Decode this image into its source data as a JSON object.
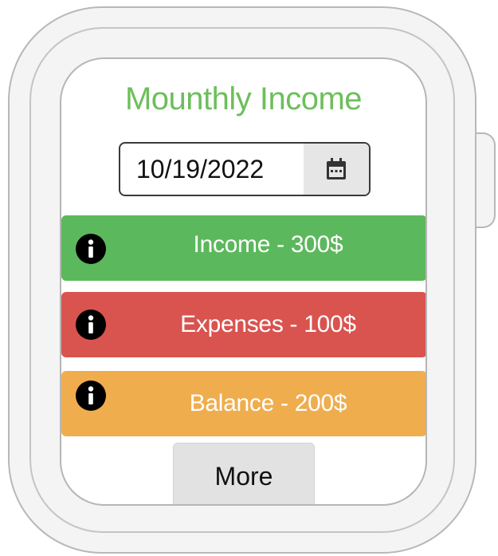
{
  "screen": {
    "title": "Mounthly Income",
    "date": {
      "value": "10/19/2022",
      "picker_icon": "calendar-icon"
    },
    "cards": [
      {
        "label": "Income - 300$",
        "icon": "info-icon",
        "color": "#5cb85c"
      },
      {
        "label": "Expenses - 100$",
        "icon": "info-icon",
        "color": "#d9534f"
      },
      {
        "label": "Balance - 200$",
        "icon": "info-icon",
        "color": "#f0ad4e"
      }
    ],
    "more_label": "More"
  },
  "colors": {
    "title": "#6cbf5a",
    "income": "#5cb85c",
    "expenses": "#d9534f",
    "balance": "#f0ad4e",
    "button": "#e2e2e2"
  }
}
